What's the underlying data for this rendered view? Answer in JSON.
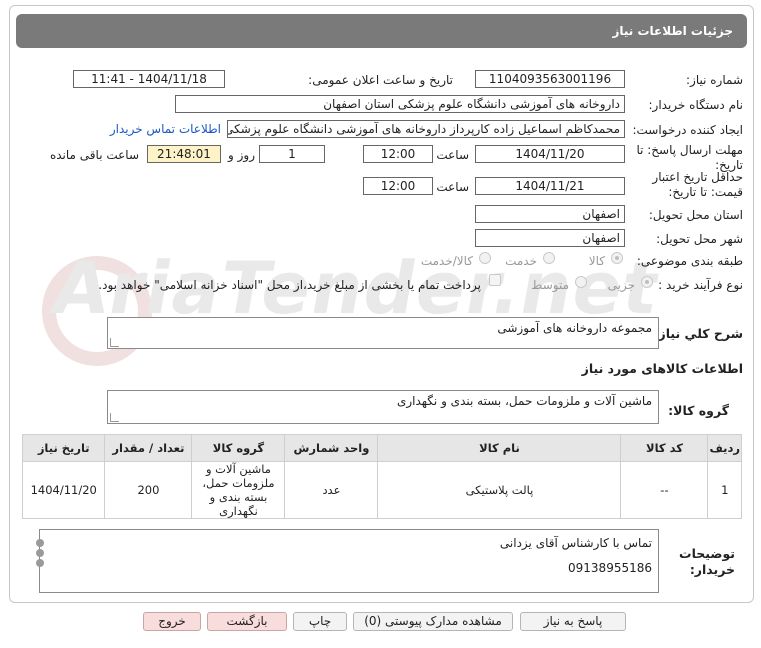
{
  "header": {
    "title": "جزئیات اطلاعات نیاز"
  },
  "fields": {
    "need_number_label": "شماره نیاز:",
    "need_number": "1104093563001196",
    "announce_label": "تاریخ و ساعت اعلان عمومی:",
    "announce_value": "1404/11/18 - 11:41",
    "buyer_org_label": "نام دستگاه خریدار:",
    "buyer_org": "داروخانه های آموزشی دانشگاه علوم پزشکی استان اصفهان",
    "requester_label": "ایجاد کننده درخواست:",
    "requester": "محمدکاظم اسماعیل زاده کارپرداز داروخانه های آموزشی دانشگاه علوم پزشکی",
    "buyer_contact_link": "اطلاعات تماس خریدار",
    "deadline_label_1": "مهلت ارسال پاسخ: تا",
    "deadline_label_2": "تاریخ:",
    "deadline_date": "1404/11/20",
    "time_word": "ساعت",
    "deadline_time": "12:00",
    "days_value": "1",
    "days_word": "روز و",
    "remaining_time": "21:48:01",
    "remaining_word": "ساعت باقی مانده",
    "validity_label_1": "حداقل تاریخ اعتبار",
    "validity_label_2": "قیمت: تا تاریخ:",
    "validity_date": "1404/11/21",
    "validity_time": "12:00",
    "province_label": "استان محل تحویل:",
    "province": "اصفهان",
    "city_label": "شهر محل تحویل:",
    "city": "اصفهان",
    "category_label": "طبقه بندی موضوعی:",
    "category_options": [
      "کالا",
      "خدمت",
      "کالا/خدمت"
    ],
    "process_label": "نوع فرآیند خرید :",
    "process_options": [
      "جزیی",
      "متوسط"
    ],
    "payment_note": "پرداخت تمام یا بخشی از مبلغ خرید،از محل \"اسناد خزانه اسلامی\" خواهد بود."
  },
  "summary": {
    "label": "شرح کلي نیاز:",
    "value": "مجموعه داروخانه های آموزشی"
  },
  "goods_section": {
    "title": "اطلاعات کالاهای مورد نیاز"
  },
  "goods_group": {
    "label": "گروه کالا:",
    "value": "ماشین آلات و ملزومات حمل، بسته بندی و نگهداری"
  },
  "table": {
    "headers": [
      "ردیف",
      "کد کالا",
      "نام کالا",
      "واحد شمارش",
      "گروه کالا",
      "تعداد / مقدار",
      "تاریخ نیاز"
    ],
    "rows": [
      {
        "row": "1",
        "code": "--",
        "name": "پالت پلاستیکی",
        "unit": "عدد",
        "group": "ماشین آلات و ملزومات حمل، بسته بندی و نگهداری",
        "qty": "200",
        "date": "1404/11/20"
      }
    ]
  },
  "buyer_notes": {
    "label_1": "توضیحات",
    "label_2": "خریدار:",
    "line_1": "تماس با کارشناس آقای یزدانی",
    "line_2": "09138955186"
  },
  "buttons": {
    "reply": "پاسخ به نیاز",
    "attachments": "مشاهده مدارک پیوستی (0)",
    "print": "چاپ",
    "back": "بازگشت",
    "exit": "خروج"
  },
  "watermark": {
    "text": "AriaTender.net"
  }
}
